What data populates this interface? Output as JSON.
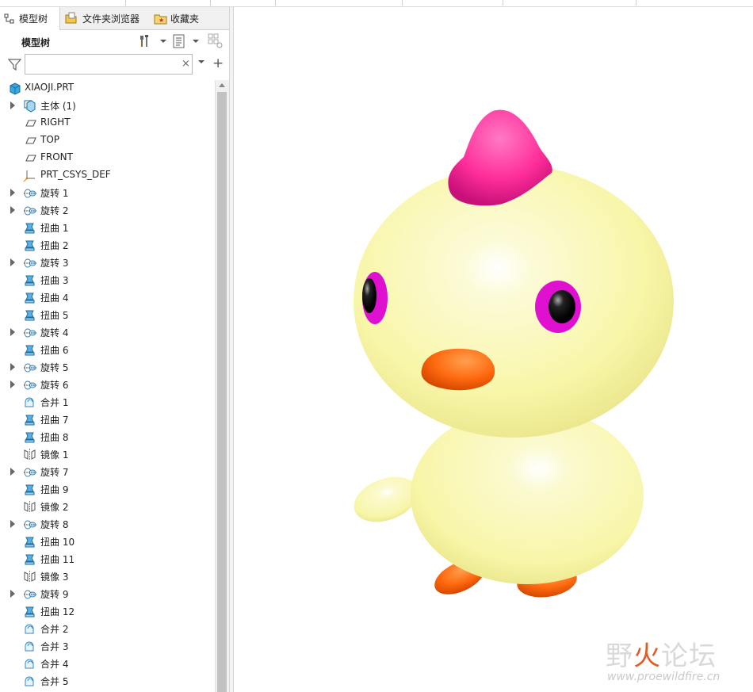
{
  "tabs": [
    {
      "label": "模型树",
      "icon": "model-tree-icon",
      "active": true
    },
    {
      "label": "文件夹浏览器",
      "icon": "folder-browser-icon",
      "active": false
    },
    {
      "label": "收藏夹",
      "icon": "favorites-icon",
      "active": false
    }
  ],
  "panel": {
    "title": "模型树",
    "settings_icon": "tools-icon",
    "show_icon": "list-view-icon",
    "filter_icon": "filter-icon",
    "search": {
      "value": "",
      "placeholder": ""
    },
    "clear_symbol": "×",
    "add_symbol": "+"
  },
  "tree": {
    "root": {
      "label": "XIAOJI.PRT",
      "icon": "part-icon"
    },
    "items": [
      {
        "label": "主体 (1)",
        "icon": "body-icon",
        "expandable": true
      },
      {
        "label": "RIGHT",
        "icon": "datum-plane-icon",
        "expandable": false
      },
      {
        "label": "TOP",
        "icon": "datum-plane-icon",
        "expandable": false
      },
      {
        "label": "FRONT",
        "icon": "datum-plane-icon",
        "expandable": false
      },
      {
        "label": "PRT_CSYS_DEF",
        "icon": "coordinate-system-icon",
        "expandable": false
      },
      {
        "label": "旋转 1",
        "icon": "revolve-icon",
        "expandable": true
      },
      {
        "label": "旋转 2",
        "icon": "revolve-icon",
        "expandable": true
      },
      {
        "label": "扭曲 1",
        "icon": "warp-icon",
        "expandable": false
      },
      {
        "label": "扭曲 2",
        "icon": "warp-icon",
        "expandable": false
      },
      {
        "label": "旋转 3",
        "icon": "revolve-icon",
        "expandable": true
      },
      {
        "label": "扭曲 3",
        "icon": "warp-icon",
        "expandable": false
      },
      {
        "label": "扭曲 4",
        "icon": "warp-icon",
        "expandable": false
      },
      {
        "label": "扭曲 5",
        "icon": "warp-icon",
        "expandable": false
      },
      {
        "label": "旋转 4",
        "icon": "revolve-icon",
        "expandable": true
      },
      {
        "label": "扭曲 6",
        "icon": "warp-icon",
        "expandable": false
      },
      {
        "label": "旋转 5",
        "icon": "revolve-icon",
        "expandable": true
      },
      {
        "label": "旋转 6",
        "icon": "revolve-icon",
        "expandable": true
      },
      {
        "label": "合并 1",
        "icon": "merge-icon",
        "expandable": false
      },
      {
        "label": "扭曲 7",
        "icon": "warp-icon",
        "expandable": false
      },
      {
        "label": "扭曲 8",
        "icon": "warp-icon",
        "expandable": false
      },
      {
        "label": "镜像 1",
        "icon": "mirror-icon",
        "expandable": false
      },
      {
        "label": "旋转 7",
        "icon": "revolve-icon",
        "expandable": true
      },
      {
        "label": "扭曲 9",
        "icon": "warp-icon",
        "expandable": false
      },
      {
        "label": "镜像 2",
        "icon": "mirror-icon",
        "expandable": false
      },
      {
        "label": "旋转 8",
        "icon": "revolve-icon",
        "expandable": true
      },
      {
        "label": "扭曲 10",
        "icon": "warp-icon",
        "expandable": false
      },
      {
        "label": "扭曲 11",
        "icon": "warp-icon",
        "expandable": false
      },
      {
        "label": "镜像 3",
        "icon": "mirror-icon",
        "expandable": false
      },
      {
        "label": "旋转 9",
        "icon": "revolve-icon",
        "expandable": true
      },
      {
        "label": "扭曲 12",
        "icon": "warp-icon",
        "expandable": false
      },
      {
        "label": "合并 2",
        "icon": "merge-icon",
        "expandable": false
      },
      {
        "label": "合并 3",
        "icon": "merge-icon",
        "expandable": false
      },
      {
        "label": "合并 4",
        "icon": "merge-icon",
        "expandable": false
      },
      {
        "label": "合并 5",
        "icon": "merge-icon",
        "expandable": false
      }
    ]
  },
  "viewport": {
    "model": "chick-3d-model",
    "colors": {
      "body": "#f8f6a8",
      "crest": "#ff2e9a",
      "beak": "#ff6a10",
      "eye_ring": "#e010d0",
      "pupil": "#000000"
    }
  },
  "watermark": {
    "brand": "野火论坛",
    "url": "www.proewildfire.cn"
  }
}
